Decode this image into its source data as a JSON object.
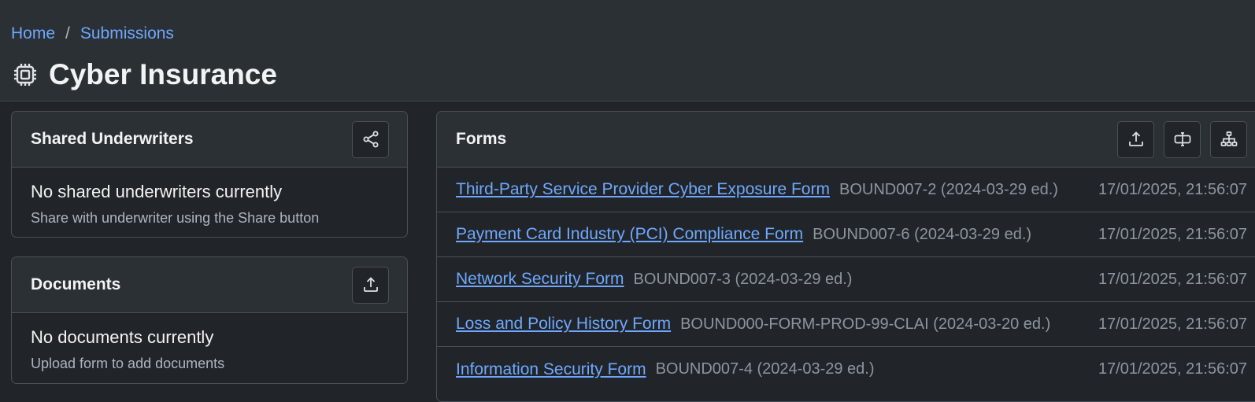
{
  "breadcrumb": {
    "home": "Home",
    "separator": "/",
    "submissions": "Submissions"
  },
  "page": {
    "title": "Cyber Insurance",
    "icon": "cpu-chip-icon"
  },
  "shared_underwriters": {
    "title": "Shared Underwriters",
    "share_icon": "share-icon",
    "empty_title": "No shared underwriters currently",
    "empty_sub": "Share with underwriter using the Share button"
  },
  "documents": {
    "title": "Documents",
    "upload_icon": "upload-icon",
    "empty_title": "No documents currently",
    "empty_sub": "Upload form to add documents"
  },
  "forms": {
    "title": "Forms",
    "toolbar_icons": [
      "upload-icon",
      "text-cursor-icon",
      "sitemap-icon"
    ],
    "items": [
      {
        "name": "Third-Party Service Provider Cyber Exposure Form",
        "code": "BOUND007-2 (2024-03-29 ed.)",
        "date": "17/01/2025, 21:56:07"
      },
      {
        "name": "Payment Card Industry (PCI) Compliance Form",
        "code": "BOUND007-6 (2024-03-29 ed.)",
        "date": "17/01/2025, 21:56:07"
      },
      {
        "name": "Network Security Form",
        "code": "BOUND007-3 (2024-03-29 ed.)",
        "date": "17/01/2025, 21:56:07"
      },
      {
        "name": "Loss and Policy History Form",
        "code": "BOUND000-FORM-PROD-99-CLAI (2024-03-20 ed.)",
        "date": "17/01/2025, 21:56:07"
      },
      {
        "name": "Information Security Form",
        "code": "BOUND007-4 (2024-03-29 ed.)",
        "date": "17/01/2025, 21:56:07"
      }
    ]
  }
}
